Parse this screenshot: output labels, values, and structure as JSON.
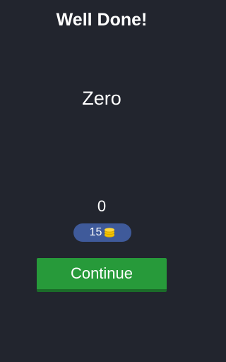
{
  "header": {
    "title": "Well Done!"
  },
  "result": {
    "answer": "Zero",
    "score": "0"
  },
  "reward": {
    "coins": "15",
    "icon": "coin-stack-icon"
  },
  "actions": {
    "continue_label": "Continue"
  },
  "colors": {
    "background": "#22252e",
    "pill": "#3f5a9a",
    "button": "#279a3a",
    "button_shadow": "#1b6b29",
    "coin": "#f2c200"
  }
}
